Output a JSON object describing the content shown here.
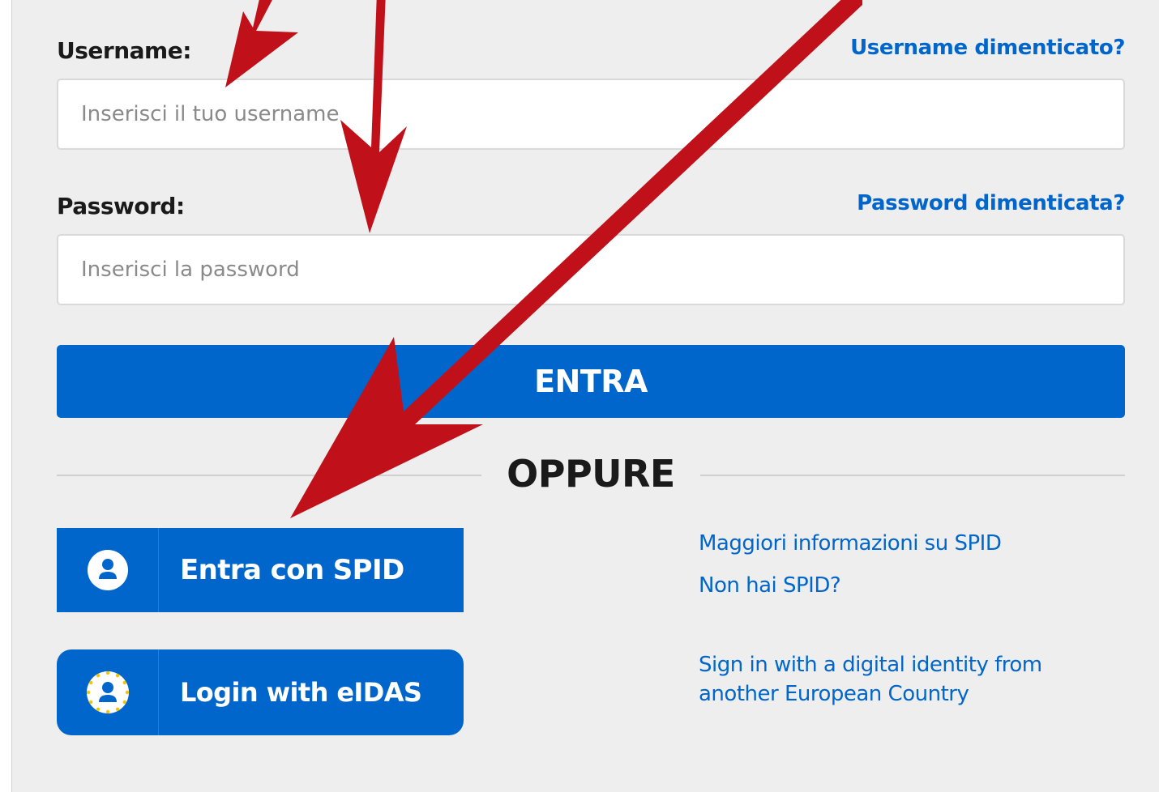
{
  "login_form": {
    "username": {
      "label": "Username:",
      "placeholder": "Inserisci il tuo username",
      "forgot_link": "Username dimenticato?"
    },
    "password": {
      "label": "Password:",
      "placeholder": "Inserisci la password",
      "forgot_link": "Password dimenticata?"
    },
    "submit_label": "ENTRA"
  },
  "separator": {
    "label": "OPPURE"
  },
  "spid": {
    "button_label": "Entra con SPID",
    "icon": "user-icon",
    "more_info_link": "Maggiori informazioni su SPID",
    "no_spid_link": "Non hai SPID?"
  },
  "eidas": {
    "button_label": "Login with eIDAS",
    "icon": "eidas-user-stars-icon",
    "description_line1": "Sign in with a digital identity from",
    "description_line2": "another European Country"
  },
  "colors": {
    "accent": "#0066cc",
    "panel_background": "#eeeeee",
    "annotation_arrow": "#c0111a"
  }
}
